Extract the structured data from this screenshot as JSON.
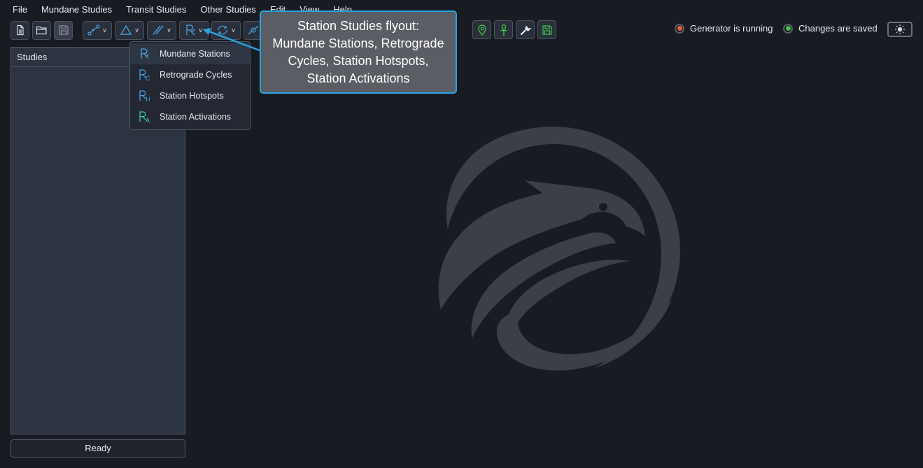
{
  "menu": [
    "File",
    "Mundane Studies",
    "Transit Studies",
    "Other Studies",
    "Edit",
    "View",
    "Help"
  ],
  "toolbar": {
    "icons": [
      "new-file-icon",
      "open-folder-icon",
      "save-icon",
      "graph-node-icon",
      "triangle-icon",
      "parallel-lines-icon",
      "station-rx-icon",
      "cycle-icon",
      "target-icon"
    ],
    "right_icons": [
      "map-pin-icon",
      "ankh-icon",
      "wrench-icon",
      "save-disk-icon"
    ]
  },
  "status": {
    "generator": "Generator is running",
    "generator_color": "#e8643c",
    "saved": "Changes are saved",
    "saved_color": "#3ec44a"
  },
  "studies": {
    "title": "Studies"
  },
  "statusbar": {
    "text": "Ready"
  },
  "dropdown": {
    "items": [
      {
        "label": "Mundane Stations",
        "sub": "",
        "icon": "rx-icon"
      },
      {
        "label": "Retrograde Cycles",
        "sub": "C",
        "icon": "rx-c-icon"
      },
      {
        "label": "Station Hotspots",
        "sub": "H",
        "icon": "rx-h-icon"
      },
      {
        "label": "Station Activations",
        "sub": "A",
        "icon": "rx-a-icon"
      }
    ]
  },
  "callout": {
    "lines": [
      "Station Studies flyout:",
      "Mundane Stations, Retrograde",
      "Cycles, Station Hotspots,",
      "Station Activations"
    ]
  },
  "colors": {
    "accent": "#2aa3e0",
    "icon_blue": "#4a9fdc",
    "icon_green": "#3ec44a",
    "background": "#191b22"
  }
}
